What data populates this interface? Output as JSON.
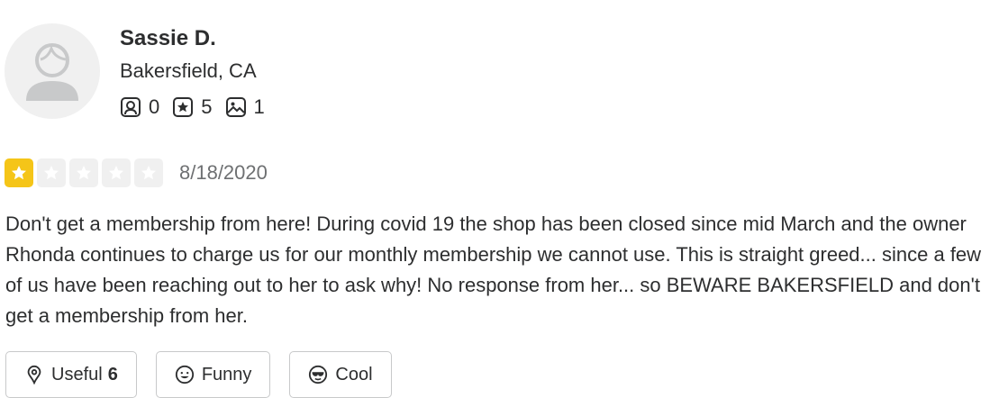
{
  "reviewer": {
    "name": "Sassie D.",
    "location": "Bakersfield, CA",
    "stats": {
      "friends": "0",
      "reviews": "5",
      "photos": "1"
    }
  },
  "review": {
    "rating": 1,
    "max_rating": 5,
    "date": "8/18/2020",
    "text": "Don't get a membership from here! During covid 19 the shop has been closed since mid March and the owner Rhonda continues to charge us for our monthly membership we cannot use. This is straight greed... since a few of us have been reaching out to her to ask why! No response from her... so BEWARE BAKERSFIELD and don't get a membership from her."
  },
  "reactions": {
    "useful_label": "Useful",
    "useful_count": "6",
    "funny_label": "Funny",
    "cool_label": "Cool"
  },
  "colors": {
    "star_filled": "#f5c518",
    "star_empty": "#f0f0f0",
    "text": "#2d2e2f",
    "muted": "#6e7072"
  }
}
